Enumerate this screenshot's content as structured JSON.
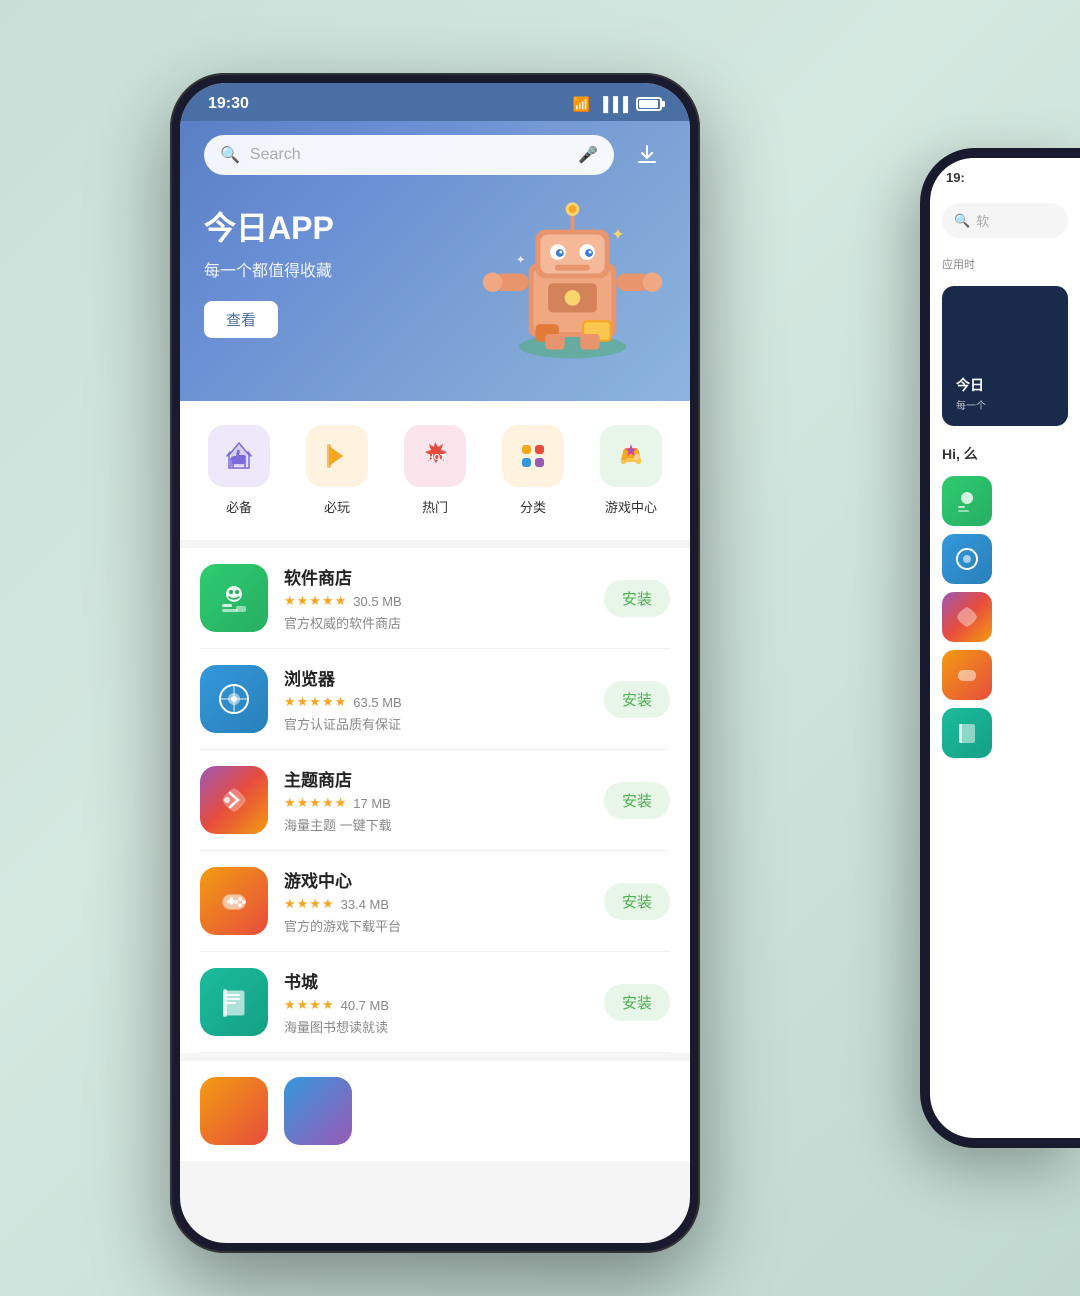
{
  "phone1": {
    "status_bar": {
      "time": "19:30"
    },
    "search": {
      "placeholder": "Search"
    },
    "banner": {
      "title": "今日APP",
      "subtitle": "每一个都值得收藏",
      "button_label": "查看"
    },
    "categories": [
      {
        "id": "essential",
        "label": "必备",
        "emoji": "👍",
        "css_class": "cat-essential"
      },
      {
        "id": "play",
        "label": "必玩",
        "emoji": "🔖",
        "css_class": "cat-play"
      },
      {
        "id": "hot",
        "label": "热门",
        "emoji": "HOT",
        "css_class": "cat-hot"
      },
      {
        "id": "category",
        "label": "分类",
        "emoji": "⊞",
        "css_class": "cat-category"
      },
      {
        "id": "gamecenter",
        "label": "游戏中心",
        "emoji": "✦",
        "css_class": "cat-game"
      }
    ],
    "apps": [
      {
        "name": "软件商店",
        "stars": "★★★★★",
        "size": "30.5 MB",
        "desc": "官方权威的软件商店",
        "install": "安装",
        "icon_class": "icon-appstore",
        "rating_full": 5
      },
      {
        "name": "浏览器",
        "stars": "★★★★★",
        "size": "63.5 MB",
        "desc": "官方认证品质有保证",
        "install": "安装",
        "icon_class": "icon-browser",
        "rating_full": 5
      },
      {
        "name": "主题商店",
        "stars": "★★★★★",
        "size": "17 MB",
        "desc": "海量主题 一键下载",
        "install": "安装",
        "icon_class": "icon-theme",
        "rating_full": 5
      },
      {
        "name": "游戏中心",
        "stars": "★★★★",
        "size": "33.4 MB",
        "desc": "官方的游戏下载平台",
        "install": "安装",
        "icon_class": "icon-game",
        "rating_full": 4
      },
      {
        "name": "书城",
        "stars": "★★★★",
        "size": "40.7 MB",
        "desc": "海量图书想读就读",
        "install": "安装",
        "icon_class": "icon-books",
        "rating_full": 4
      }
    ]
  },
  "phone2": {
    "status_time": "19:",
    "search_hint": "软",
    "section_label": "应用时",
    "banner_title": "今日",
    "banner_sub": "每一个",
    "hi_text": "Hi, 么"
  }
}
